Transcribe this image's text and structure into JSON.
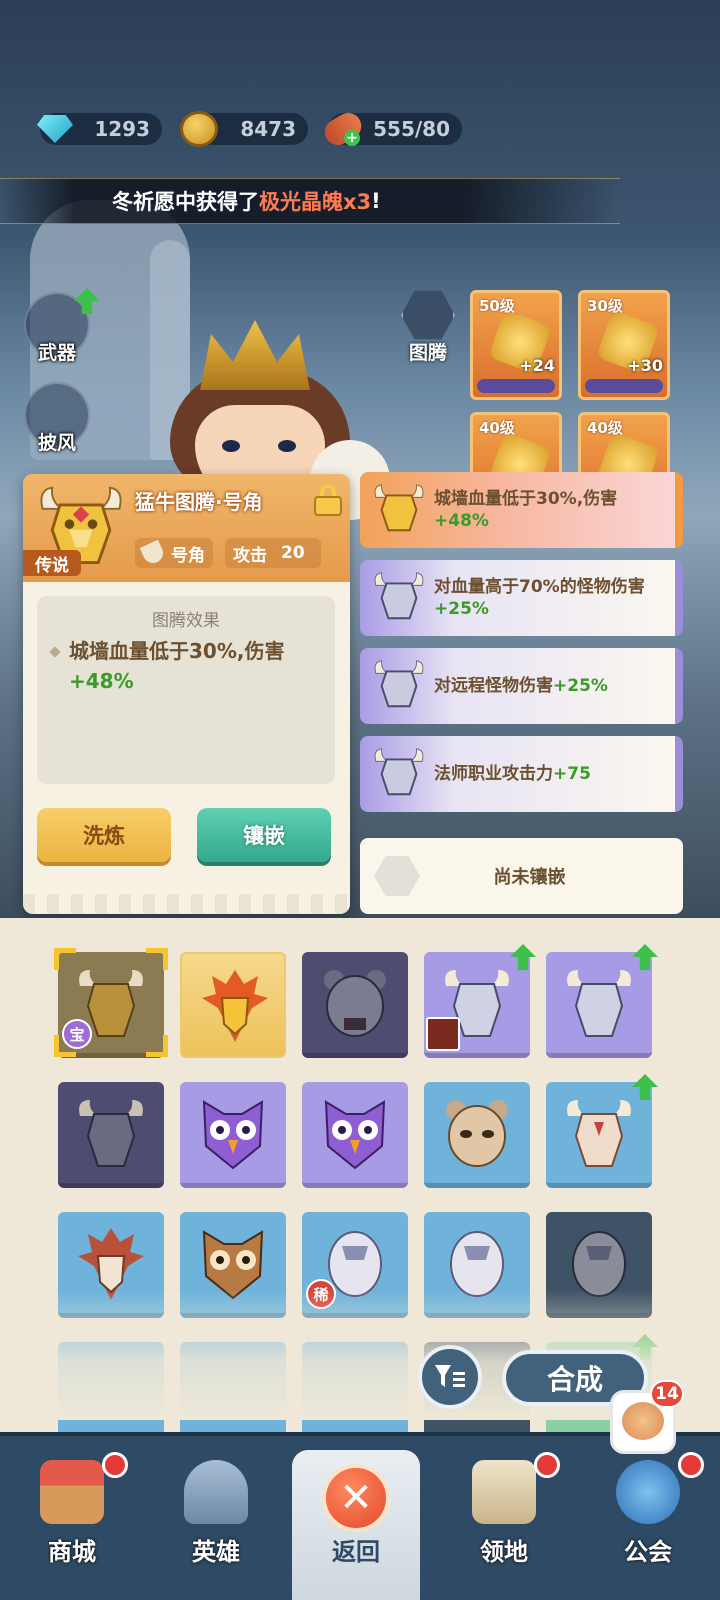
{
  "resources": {
    "gems": "1293",
    "coins": "8473",
    "stamina": "555/80"
  },
  "banner": {
    "prefix": "冬祈愿中获得了",
    "highlight": "极光晶魄x3",
    "suffix": "!"
  },
  "side_menu": {
    "weapon": "武器",
    "cape": "披风"
  },
  "totem_slot_label": "图腾",
  "equipment": [
    {
      "level": "50级",
      "bonus": "+24"
    },
    {
      "level": "30级",
      "bonus": "+30"
    },
    {
      "level": "40级",
      "bonus": ""
    },
    {
      "level": "40级",
      "bonus": ""
    }
  ],
  "detail_card": {
    "title": "猛牛图腾·号角",
    "rarity": "传说",
    "type_label": "号角",
    "attack_label": "攻击",
    "attack_value": "20",
    "effect_title": "图腾效果",
    "effect_text": "城墙血量低于30%,伤害",
    "effect_value": "+48%",
    "refine_button": "洗炼",
    "inlay_button": "镶嵌"
  },
  "inlay_slots": [
    {
      "rarity": "legend",
      "text": "城墙血量低于30%,伤害",
      "value": "+48%"
    },
    {
      "rarity": "epic",
      "text": "对血量高于70%的怪物伤害",
      "value": "+25%"
    },
    {
      "rarity": "epic",
      "text": "对远程怪物伤害",
      "value": "+25%"
    },
    {
      "rarity": "epic",
      "text": "法师职业攻击力",
      "value": "+75"
    }
  ],
  "empty_slot_text": "尚未镶嵌",
  "inventory": {
    "badges": {
      "treasure": "宝",
      "rare": "稀"
    },
    "items": [
      {
        "icon": "bull-mask-gold",
        "rarity": "dgold",
        "selected": true,
        "badge": "treasure"
      },
      {
        "icon": "phoenix-mask",
        "rarity": "gold"
      },
      {
        "icon": "bear-mask-dark",
        "rarity": "dark"
      },
      {
        "icon": "bull-mask-silver",
        "rarity": "purple",
        "upgrade": true,
        "hero": true
      },
      {
        "icon": "bull-mask-silver",
        "rarity": "purple",
        "upgrade": true
      },
      {
        "icon": "bull-mask-dark",
        "rarity": "dark"
      },
      {
        "icon": "owl-mask-purple",
        "rarity": "purple"
      },
      {
        "icon": "owl-mask-purple",
        "rarity": "purple"
      },
      {
        "icon": "bear-skull",
        "rarity": "blue"
      },
      {
        "icon": "bull-skull",
        "rarity": "blue",
        "upgrade": true
      },
      {
        "icon": "phoenix-skull",
        "rarity": "blue"
      },
      {
        "icon": "owl-mask-brown",
        "rarity": "blue"
      },
      {
        "icon": "serpent-skull",
        "rarity": "blue",
        "badge": "rare"
      },
      {
        "icon": "serpent-skull",
        "rarity": "blue"
      },
      {
        "icon": "serpent-skull-dark",
        "rarity": "slate"
      }
    ]
  },
  "actions": {
    "compose": "合成"
  },
  "nav": {
    "shop": "商城",
    "heroes": "英雄",
    "back": "返回",
    "territory": "领地",
    "guild": "公会",
    "guild_badge": "14"
  },
  "colors": {
    "legend": "#f2a259",
    "epic": "#a99ce5",
    "green_value": "#3b9a2a",
    "highlight": "#ff7a52",
    "nav_bg": "#2f4a64"
  }
}
